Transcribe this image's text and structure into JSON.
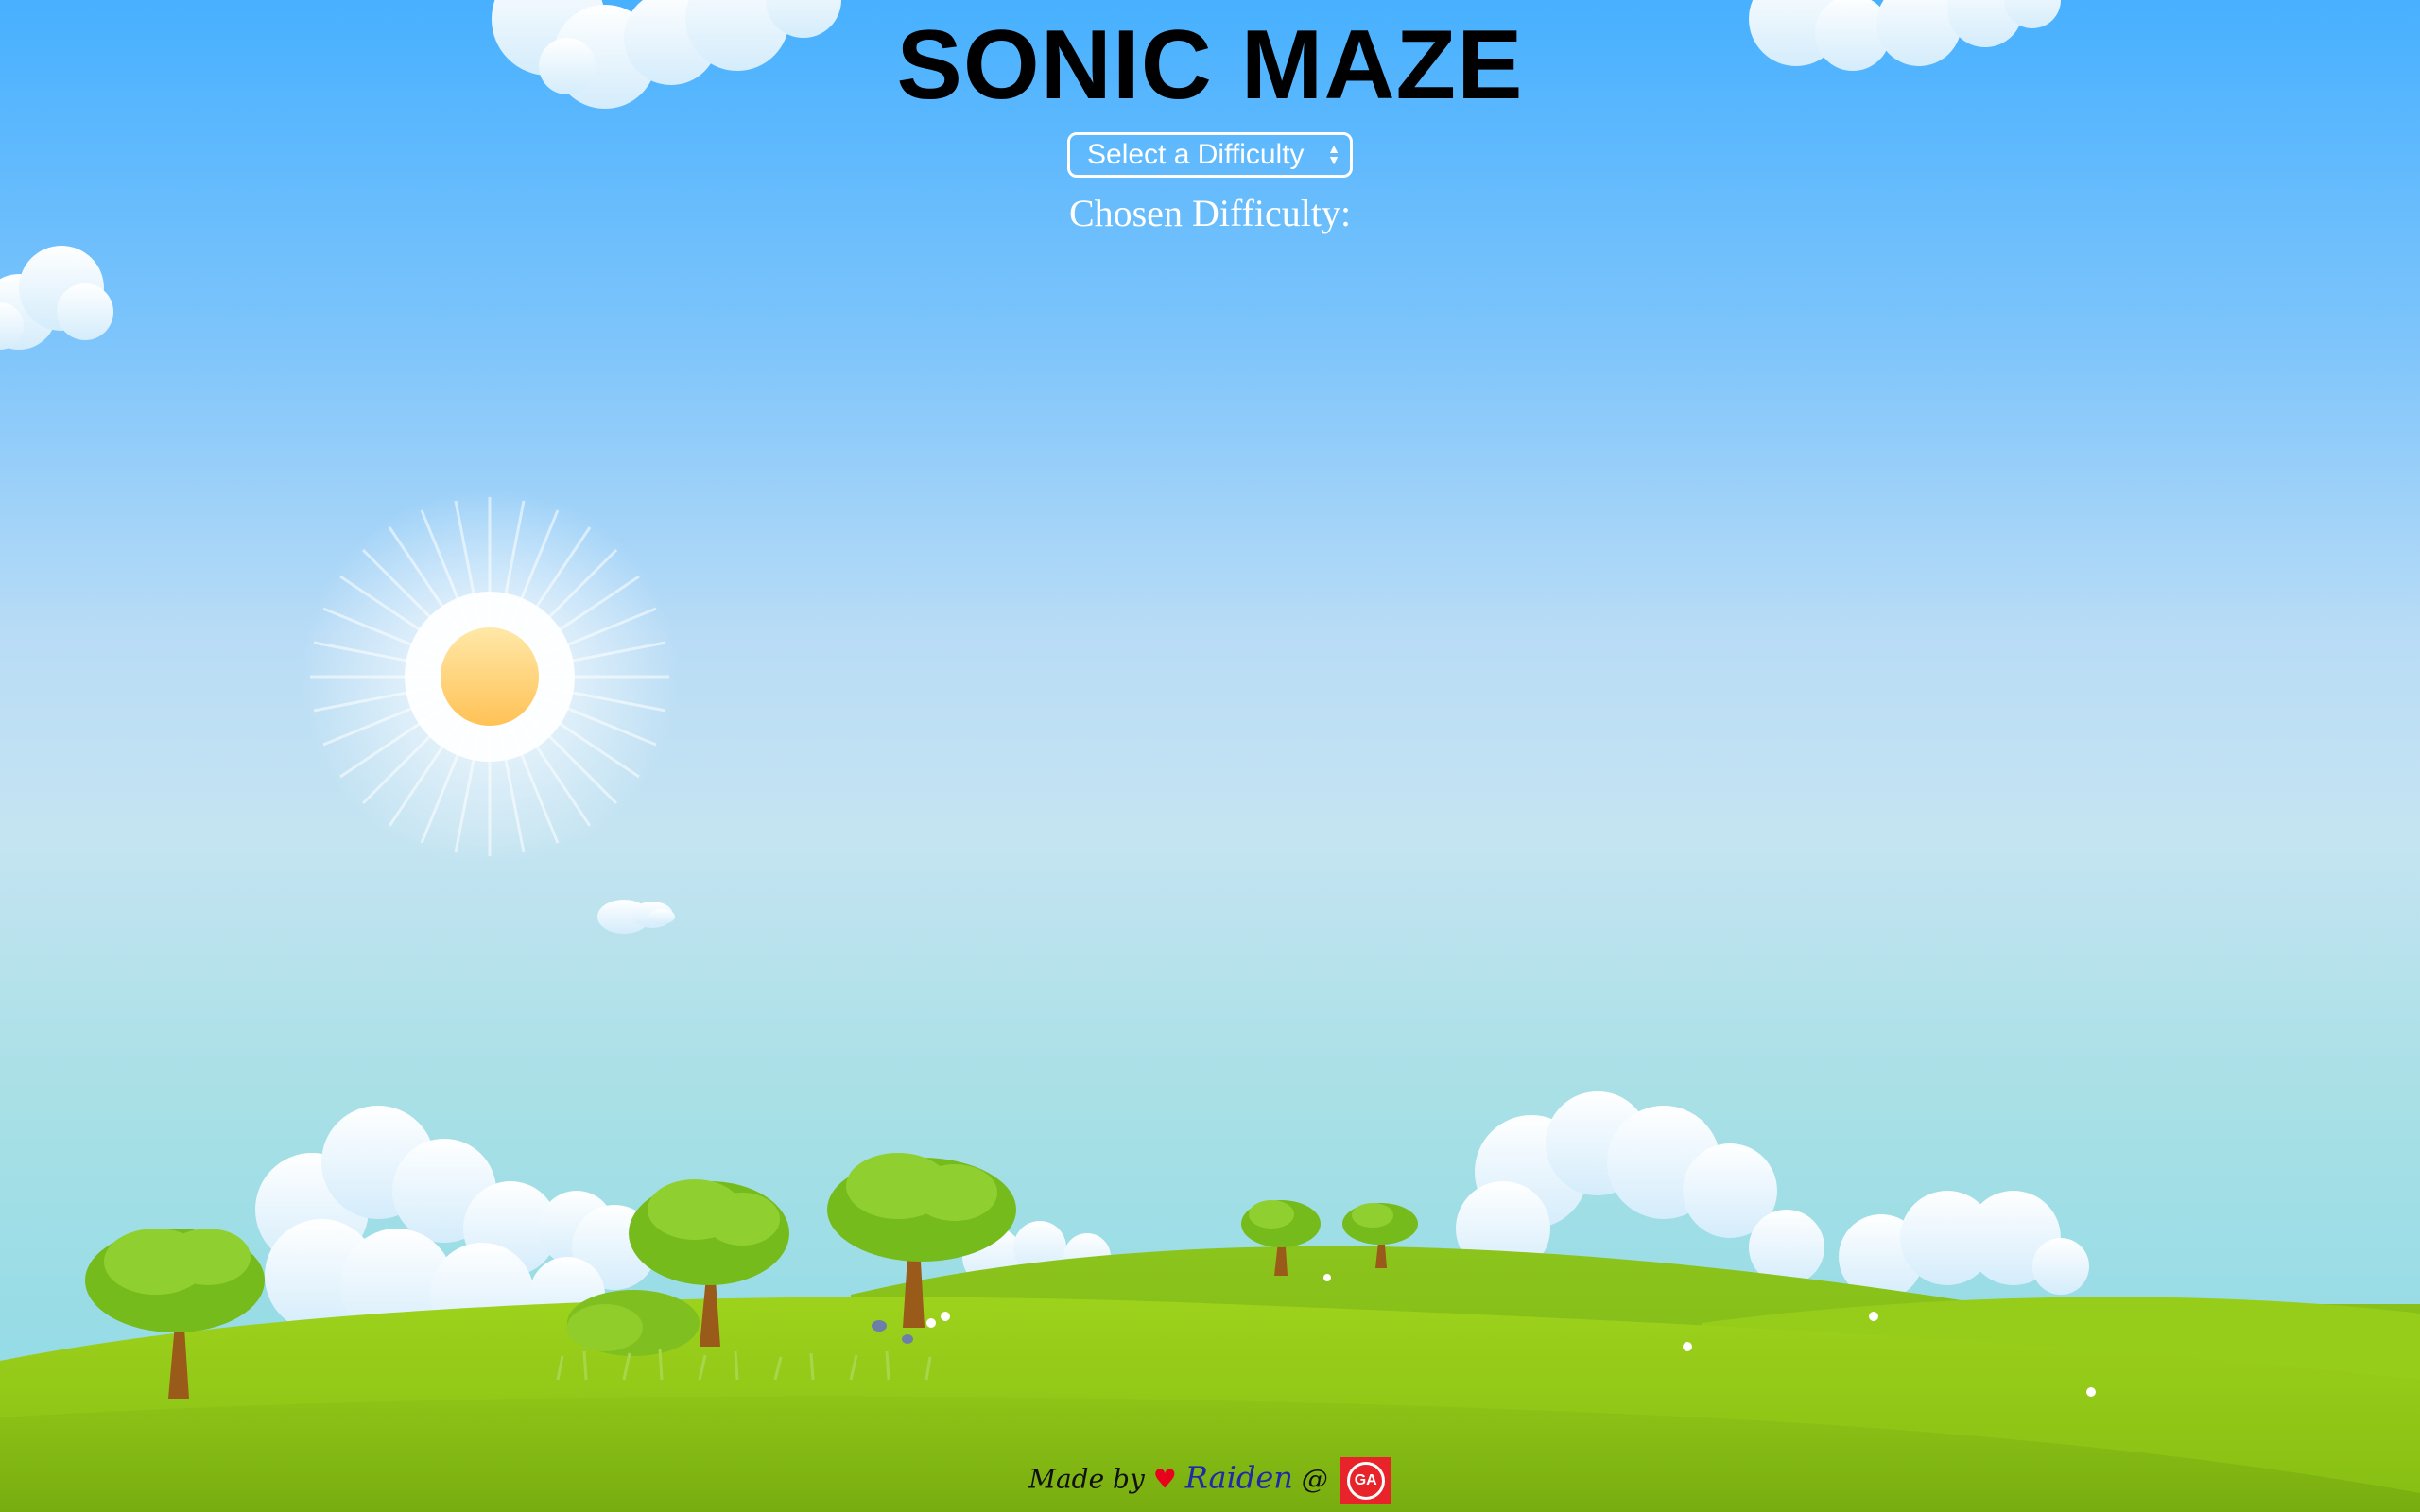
{
  "title": "SONIC MAZE",
  "difficulty_select": {
    "selected": "Select a Difficulty"
  },
  "chosen_difficulty_label": "Chosen Difficulty:",
  "footer": {
    "made_by": "Made by",
    "author": "Raiden",
    "at": "@",
    "logo_text": "GA"
  },
  "colors": {
    "sky_top": "#47b0ff",
    "sky_bottom": "#8ad9e6",
    "grass": "#8cc414",
    "sun": "#ffd36e",
    "heart": "#e8001d",
    "author": "#1f2aa8",
    "ga_logo": "#e8242a"
  }
}
